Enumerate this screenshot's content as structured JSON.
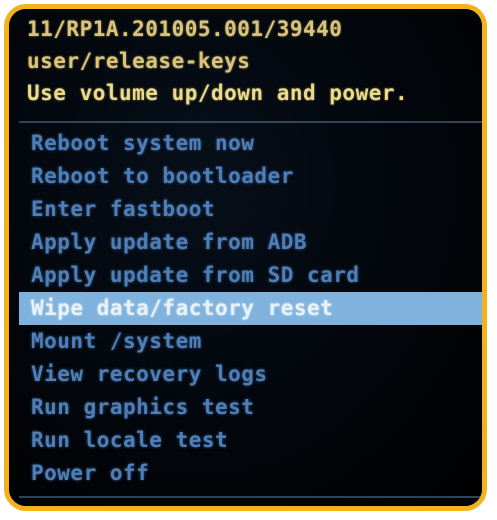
{
  "header": {
    "lines": [
      "11/RP1A.201005.001/39440",
      "user/release-keys",
      "Use volume up/down and power."
    ]
  },
  "menu": {
    "items": [
      "Reboot system now",
      "Reboot to bootloader",
      "Enter fastboot",
      "Apply update from ADB",
      "Apply update from SD card",
      "Wipe data/factory reset",
      "Mount /system",
      "View recovery logs",
      "Run graphics test",
      "Run locale test",
      "Power off"
    ],
    "selected_index": 5
  },
  "colors": {
    "frame": "#f2b21e",
    "header_text": "#d9c47a",
    "menu_text": "#4f7fb8",
    "selection_bg": "#7fb3de",
    "selection_text": "#e8f2fb"
  }
}
